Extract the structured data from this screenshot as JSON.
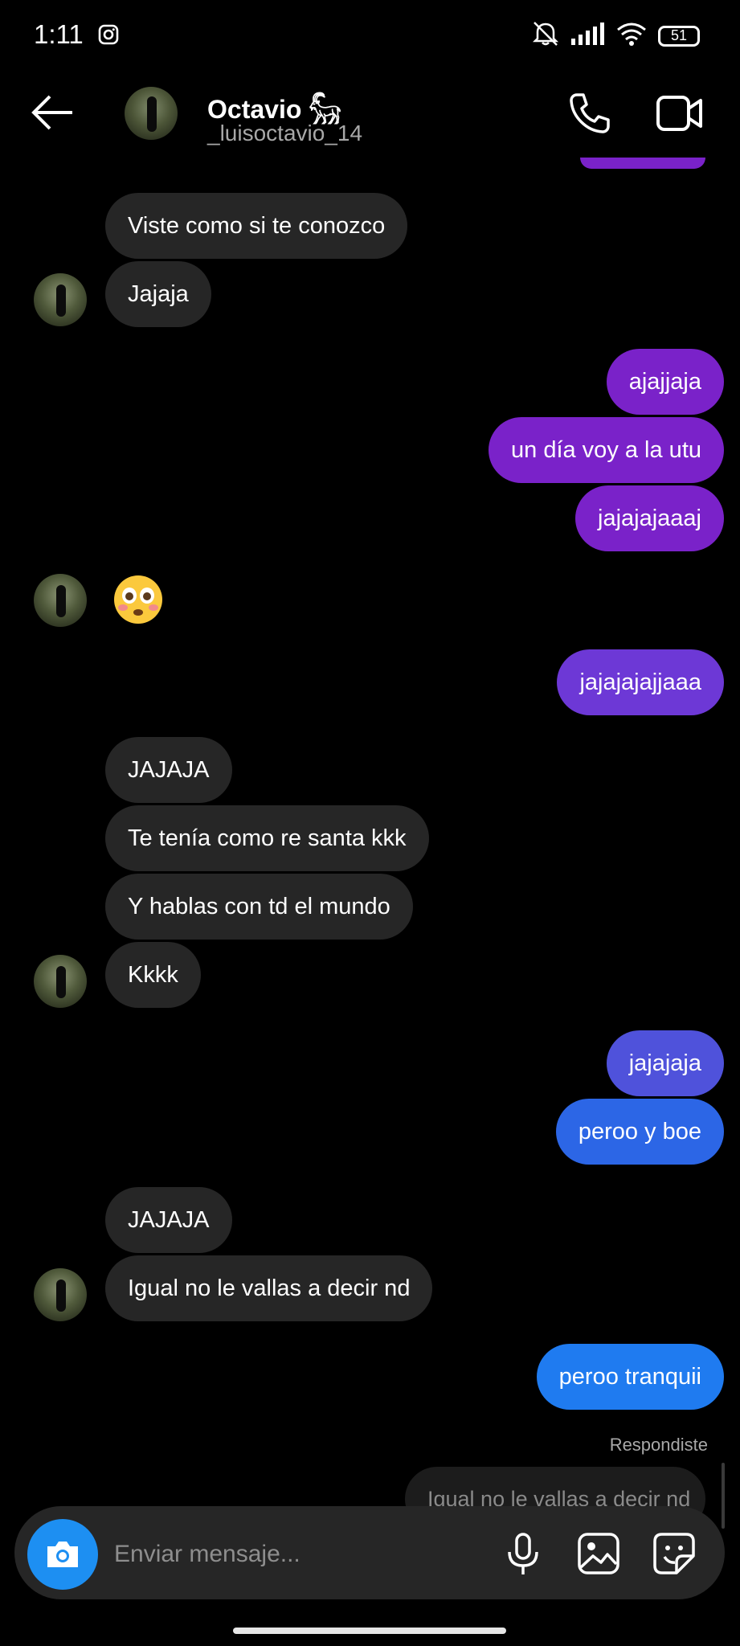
{
  "status_bar": {
    "time": "1:11",
    "battery": "51"
  },
  "header": {
    "name": "Octavio 𓃵",
    "username": "_luisoctavio_14"
  },
  "messages": {
    "m1": "Viste como si te conozco",
    "m2": "Jajaja",
    "m3": "ajajjaja",
    "m4": "un día voy a la utu",
    "m5": "jajajajaaaj",
    "m6": "😳",
    "m7": "jajajajajjaaa",
    "m8": "JAJAJA",
    "m9": "Te tenía como re santa kkk",
    "m10": "Y hablas con td el mundo",
    "m11": "Kkkk",
    "m12": "jajajaja",
    "m13": "peroo y boe",
    "m14": "JAJAJA",
    "m15": "Igual no le vallas a decir nd",
    "m16": "peroo tranquii"
  },
  "reply": {
    "label": "Respondiste",
    "quoted": "Igual no le vallas a decir nd"
  },
  "composer": {
    "placeholder": "Enviar mensaje..."
  },
  "colors": {
    "purple": "#7a22c9",
    "violet": "#6d38d6",
    "indigo": "#4f52db",
    "blue": "#2c66e6",
    "bright_blue": "#1f7bf0",
    "incoming": "#262626",
    "camera": "#1d8ff2"
  },
  "icons": [
    "instagram-icon",
    "mute-icon",
    "signal-icon",
    "wifi-icon",
    "battery-icon",
    "back-arrow-icon",
    "phone-icon",
    "video-icon",
    "camera-icon",
    "mic-icon",
    "gallery-icon",
    "sticker-icon"
  ]
}
